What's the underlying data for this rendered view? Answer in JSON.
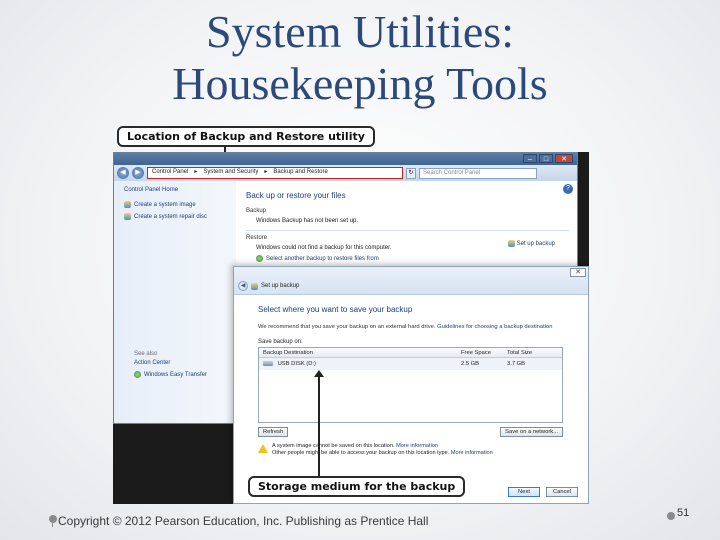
{
  "slide": {
    "title_line1": "System Utilities:",
    "title_line2": "Housekeeping Tools",
    "footer": "Copyright © 2012 Pearson Education, Inc. Publishing as Prentice Hall",
    "page_number": "51"
  },
  "callouts": {
    "top": "Location of Backup and Restore utility",
    "bottom": "Storage medium for the backup"
  },
  "control_panel": {
    "window_buttons": {
      "minimize": "–",
      "maximize": "□",
      "close": "✕"
    },
    "breadcrumb": [
      "Control Panel",
      "System and Security",
      "Backup and Restore"
    ],
    "search_placeholder": "Search Control Panel",
    "sidebar": {
      "home": "Control Panel Home",
      "items": [
        "Create a system image",
        "Create a system repair disc"
      ],
      "see_also_title": "See also",
      "see_also_items": [
        "Action Center",
        "Windows Easy Transfer"
      ]
    },
    "main": {
      "heading": "Back up or restore your files",
      "backup_label": "Backup",
      "backup_status": "Windows Backup has not been set up.",
      "setup_link": "Set up backup",
      "restore_label": "Restore",
      "restore_status": "Windows could not find a backup for this computer.",
      "restore_link": "Select another backup to restore files from"
    }
  },
  "dialog": {
    "title": "Set up backup",
    "close": "✕",
    "heading": "Select where you want to save your backup",
    "description": "We recommend that you save your backup on an external hard drive.",
    "description_link": "Guidelines for choosing a backup destination",
    "save_on_label": "Save backup on:",
    "columns": [
      "Backup Destination",
      "Free Space",
      "Total Size"
    ],
    "rows": [
      {
        "destination": "USB DISK (D:)",
        "free": "2.5 GB",
        "total": "3.7 GB"
      }
    ],
    "refresh_button": "Refresh",
    "save_network_button": "Save on a network...",
    "warning_line1": "A system image cannot be saved on this location.",
    "warning_line1_link": "More information",
    "warning_line2": "Other people might be able to access your backup on this location type.",
    "warning_line2_link": "More information",
    "next_button": "Next",
    "cancel_button": "Cancel"
  }
}
